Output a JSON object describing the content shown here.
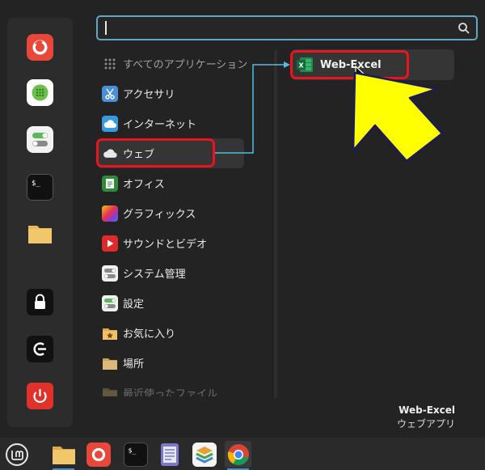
{
  "search": {
    "value": "",
    "placeholder": ""
  },
  "favorites": [
    {
      "name": "firefox-icon"
    },
    {
      "name": "calculator-icon"
    },
    {
      "name": "settings-toggle-icon"
    },
    {
      "name": "terminal-icon"
    },
    {
      "name": "folder-icon"
    },
    {
      "name": "lock-screen-icon"
    },
    {
      "name": "logout-icon"
    },
    {
      "name": "shutdown-icon"
    }
  ],
  "categories": [
    {
      "label": "すべてのアプリケーション",
      "icon": "grid-icon"
    },
    {
      "label": "アクセサリ",
      "icon": "scissors-icon"
    },
    {
      "label": "インターネット",
      "icon": "cloud-icon"
    },
    {
      "label": "ウェブ",
      "icon": "cloud-icon"
    },
    {
      "label": "オフィス",
      "icon": "office-icon"
    },
    {
      "label": "グラフィックス",
      "icon": "graphics-icon"
    },
    {
      "label": "サウンドとビデオ",
      "icon": "play-icon"
    },
    {
      "label": "システム管理",
      "icon": "system-icon"
    },
    {
      "label": "設定",
      "icon": "settings-icon"
    },
    {
      "label": "お気に入り",
      "icon": "star-folder-icon"
    },
    {
      "label": "場所",
      "icon": "folder-icon"
    },
    {
      "label": "最近使ったファイル",
      "icon": "folder-icon"
    }
  ],
  "apps": [
    {
      "label": "Web-Excel",
      "icon": "excel-icon"
    }
  ],
  "selected_app": {
    "name": "Web-Excel",
    "description": "ウェブアプリ"
  },
  "taskbar": [
    {
      "name": "mint-menu-icon"
    },
    {
      "name": "file-manager-icon"
    },
    {
      "name": "firefox-icon"
    },
    {
      "name": "terminal-icon"
    },
    {
      "name": "text-editor-icon"
    },
    {
      "name": "stack-app-icon"
    },
    {
      "name": "chrome-icon"
    }
  ],
  "colors": {
    "highlight": "#e8141e",
    "arrow_fill": "#ffff00",
    "connector": "#4fc0e0",
    "search_border": "#5fa8c8"
  }
}
